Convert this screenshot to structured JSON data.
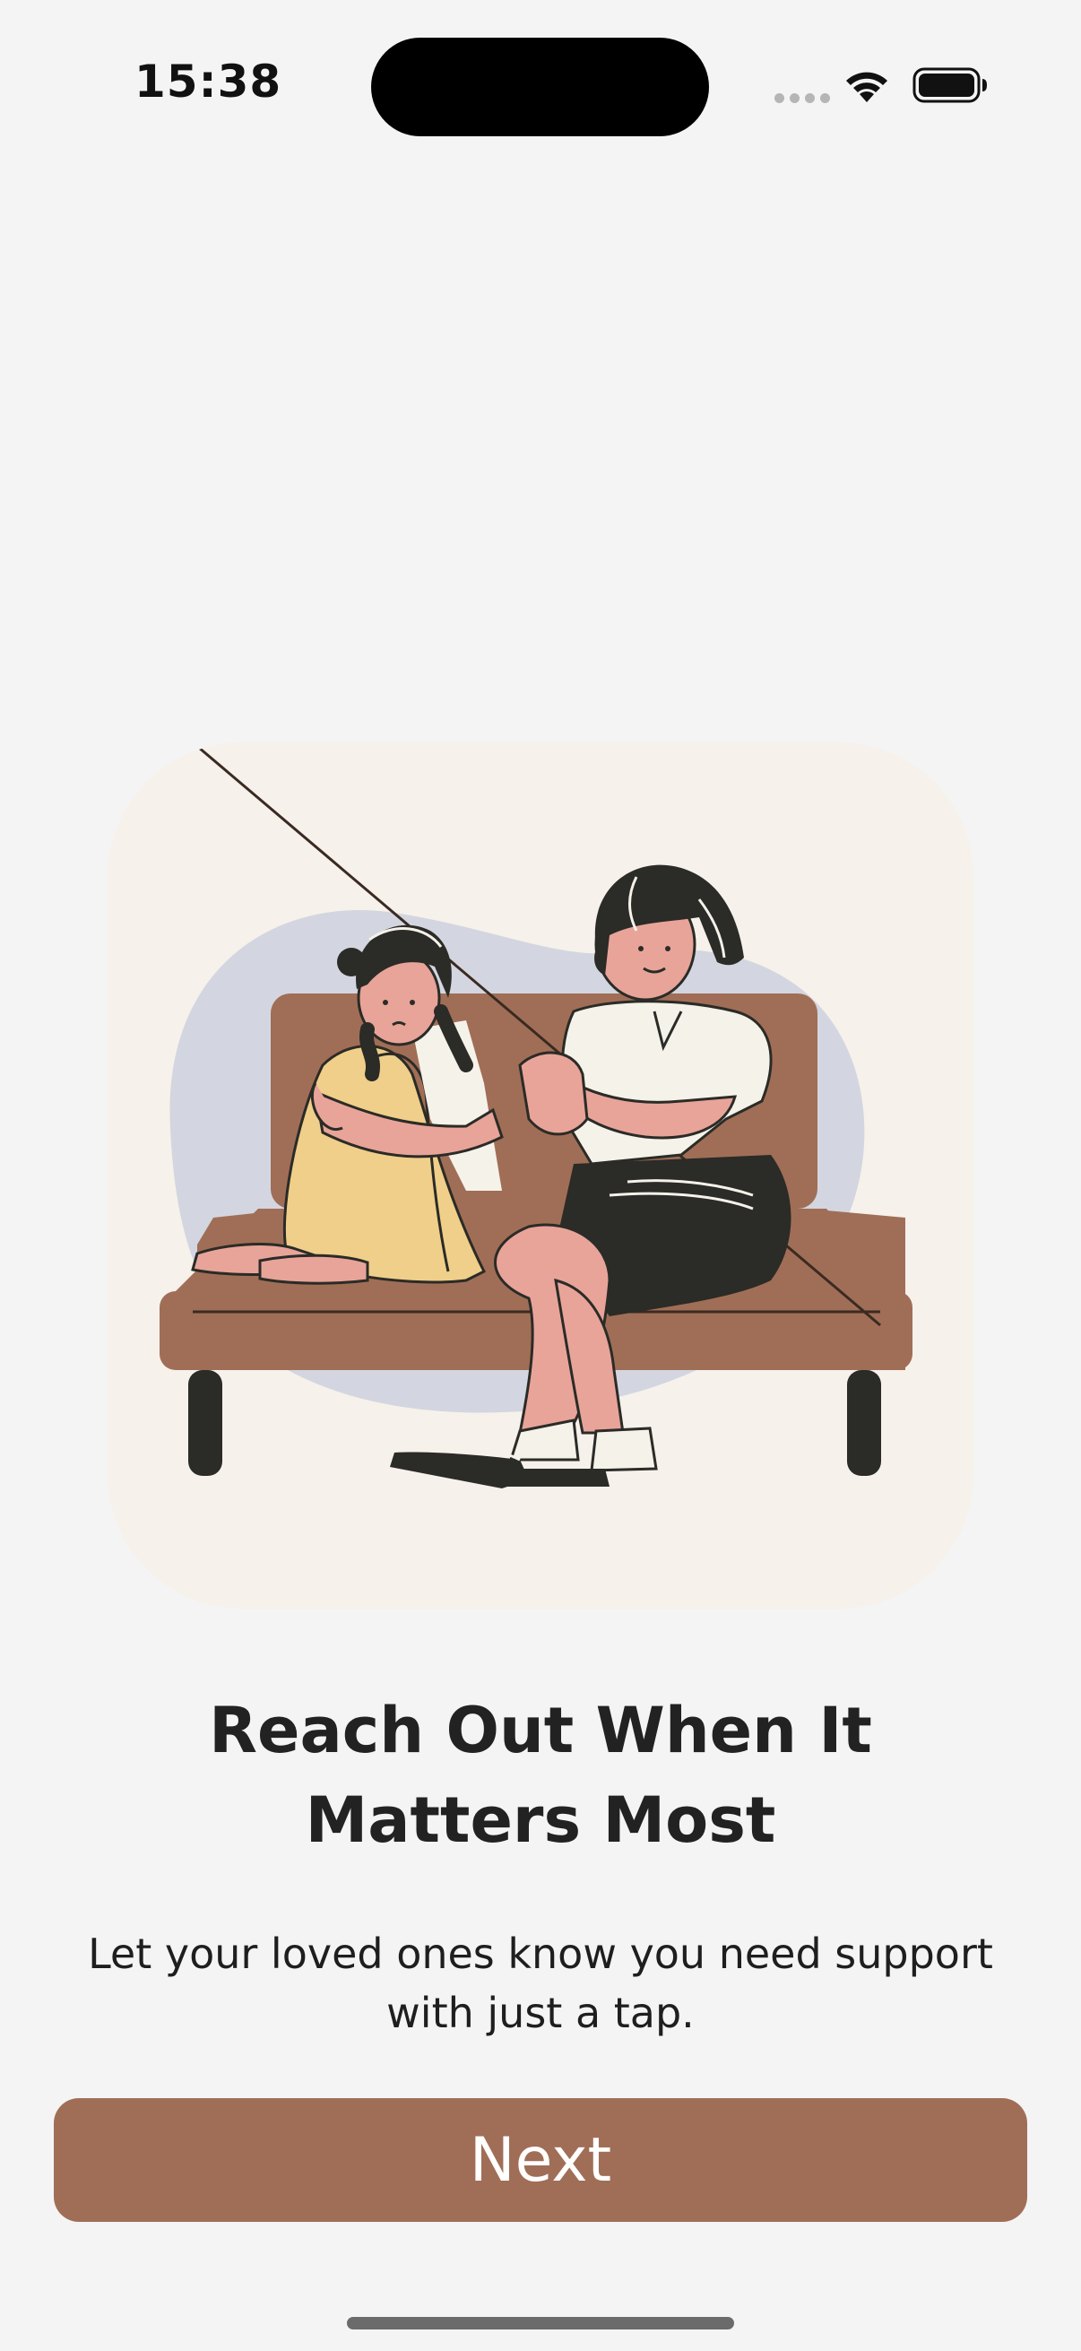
{
  "status_bar": {
    "time": "15:38",
    "icons": [
      "signal-dots-icon",
      "wifi-icon",
      "battery-icon"
    ]
  },
  "illustration": {
    "icon": "two-women-on-couch-illustration"
  },
  "onboarding": {
    "title_line1": "Reach Out When It",
    "title_line2": "Matters Most",
    "subtitle_line1": "Let your loved ones know you need support",
    "subtitle_line2": "with just a tap."
  },
  "actions": {
    "next_label": "Next"
  },
  "colors": {
    "background": "#f4f4f4",
    "card": "#f6f1ea",
    "accent": "#a06e56",
    "blob": "#d3d6e0",
    "text": "#222222"
  }
}
